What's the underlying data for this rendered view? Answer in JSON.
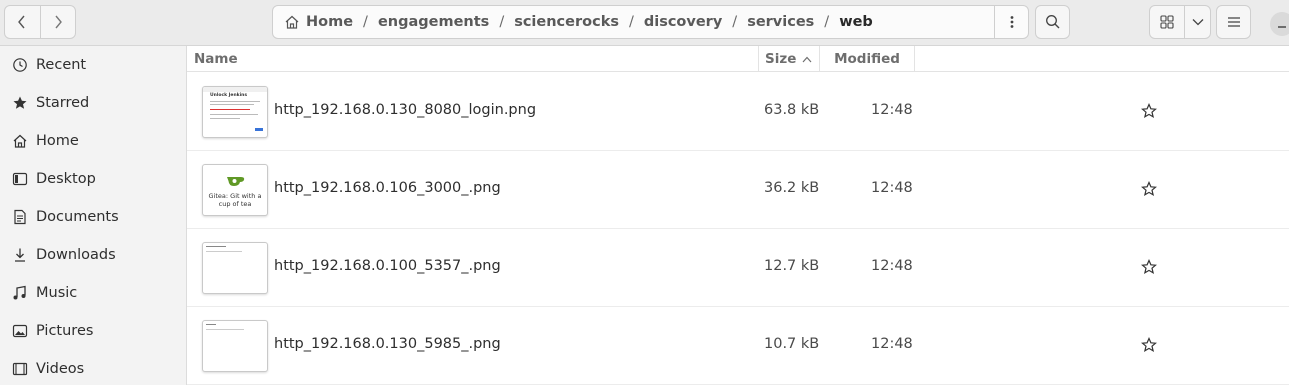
{
  "path": {
    "home": "Home",
    "segments": [
      "engagements",
      "sciencerocks",
      "discovery",
      "services"
    ],
    "current": "web",
    "separator": "/"
  },
  "sidebar": {
    "items": [
      {
        "label": "Recent",
        "icon": "clock-icon"
      },
      {
        "label": "Starred",
        "icon": "star-icon"
      },
      {
        "label": "Home",
        "icon": "home-icon"
      },
      {
        "label": "Desktop",
        "icon": "desktop-icon"
      },
      {
        "label": "Documents",
        "icon": "document-icon"
      },
      {
        "label": "Downloads",
        "icon": "download-icon"
      },
      {
        "label": "Music",
        "icon": "music-icon"
      },
      {
        "label": "Pictures",
        "icon": "picture-icon"
      },
      {
        "label": "Videos",
        "icon": "video-icon"
      }
    ]
  },
  "columns": {
    "name": "Name",
    "size": "Size",
    "modified": "Modified"
  },
  "files": [
    {
      "name": "http_192.168.0.130_8080_login.png",
      "size": "63.8 kB",
      "modified": "12:48",
      "thumb_title": "Unlock Jenkins"
    },
    {
      "name": "http_192.168.0.106_3000_.png",
      "size": "36.2 kB",
      "modified": "12:48",
      "thumb_caption": "Gitea: Git with a cup of tea"
    },
    {
      "name": "http_192.168.0.100_5357_.png",
      "size": "12.7 kB",
      "modified": "12:48"
    },
    {
      "name": "http_192.168.0.130_5985_.png",
      "size": "10.7 kB",
      "modified": "12:48"
    }
  ],
  "colors": {
    "accent": "#3873d8",
    "gitea_green": "#609926"
  }
}
